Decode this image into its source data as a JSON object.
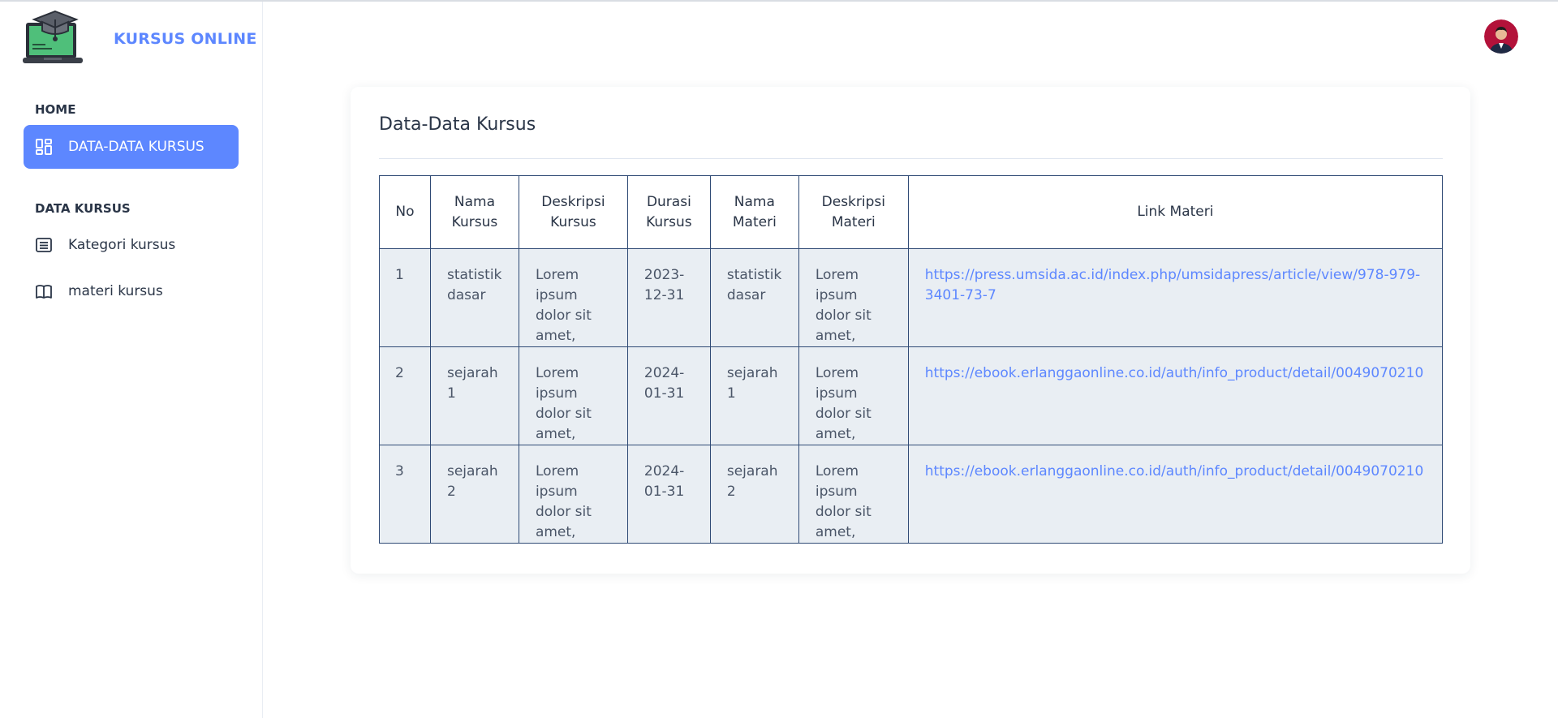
{
  "brand": {
    "name": "KURSUS ONLINE"
  },
  "sidebar": {
    "captions": [
      "HOME",
      "DATA KURSUS"
    ],
    "items": [
      {
        "label": "DATA-DATA KURSUS",
        "icon": "dashboard-icon",
        "active": true
      },
      {
        "label": "Kategori kursus",
        "icon": "list-icon",
        "active": false
      },
      {
        "label": "materi kursus",
        "icon": "book-icon",
        "active": false
      }
    ]
  },
  "header": {
    "avatar": "user-avatar"
  },
  "main": {
    "title": "Data-Data Kursus",
    "columns": [
      "No",
      "Nama Kursus",
      "Deskripsi Kursus",
      "Durasi Kursus",
      "Nama Materi",
      "Deskripsi Materi",
      "Link Materi"
    ],
    "rows": [
      [
        "1",
        "statistik dasar",
        "Lorem ipsum dolor sit amet,",
        "2023-12-31",
        "statistik dasar",
        "Lorem ipsum dolor sit amet,",
        "https://press.umsida.ac.id/index.php/umsidapress/article/view/978-979-3401-73-7"
      ],
      [
        "2",
        "sejarah 1",
        "Lorem ipsum dolor sit amet,",
        "2024-01-31",
        "sejarah 1",
        "Lorem ipsum dolor sit amet,",
        "https://ebook.erlanggaonline.co.id/auth/info_product/detail/0049070210"
      ],
      [
        "3",
        "sejarah 2",
        "Lorem ipsum dolor sit amet,",
        "2024-01-31",
        "sejarah 2",
        "Lorem ipsum dolor sit amet,",
        "https://ebook.erlanggaonline.co.id/auth/info_product/detail/0049070210"
      ]
    ]
  },
  "colors": {
    "accent": "#5d87ff",
    "text": "#2a3547",
    "row_bg": "#e9eef3",
    "table_border": "#2f4a75"
  }
}
